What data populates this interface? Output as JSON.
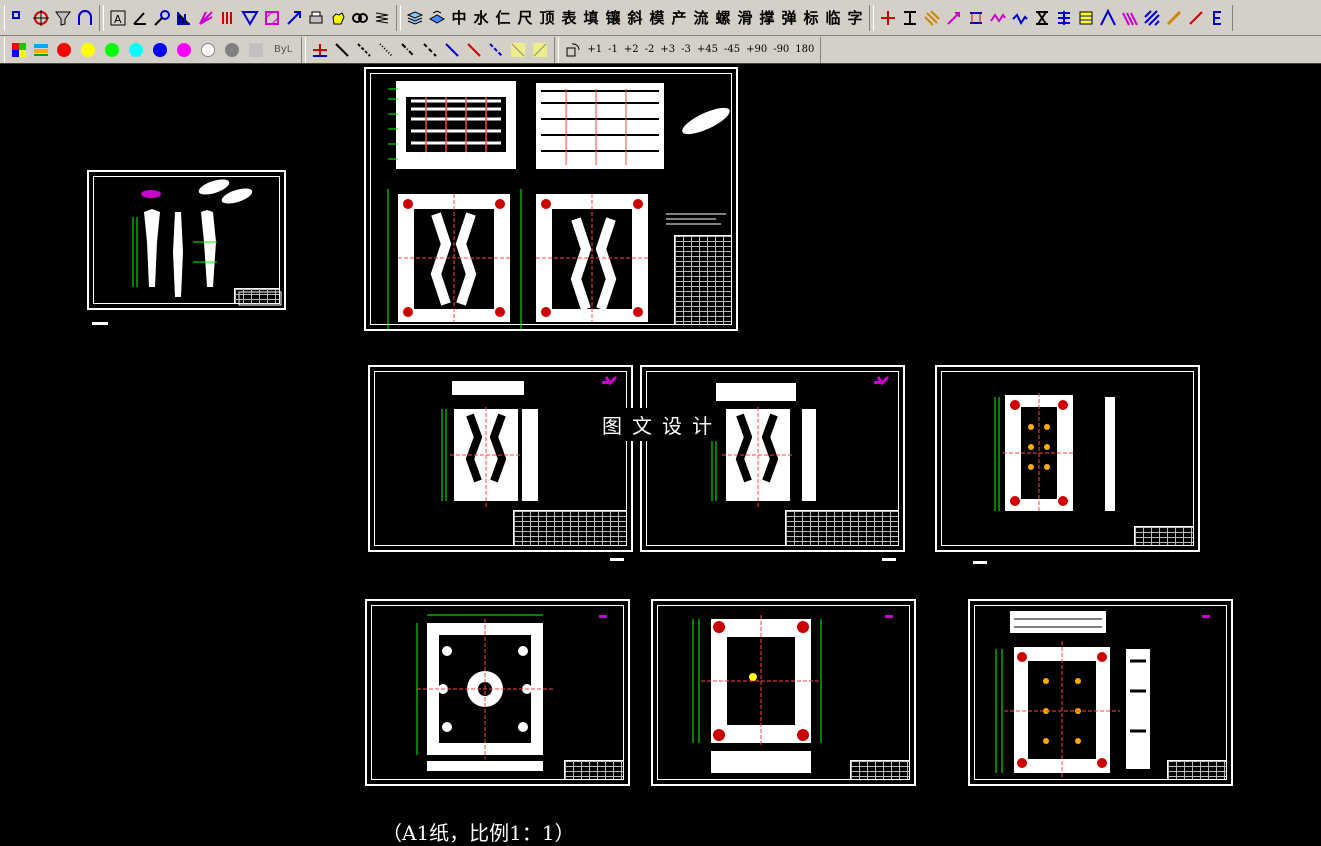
{
  "toolbar1": {
    "cad_commands": [
      "中",
      "水",
      "仁",
      "尺",
      "顶",
      "表",
      "填",
      "镶",
      "斜",
      "模",
      "产",
      "流",
      "螺",
      "滑",
      "撑",
      "弹",
      "标",
      "临",
      "字"
    ]
  },
  "toolbar2": {
    "bylayer_label": "ByL",
    "colors": [
      "#ff0000",
      "#ffff00",
      "#00ff00",
      "#00ffff",
      "#0000ff",
      "#ff00ff",
      "#ffffff",
      "#808080",
      "#c0c0c0"
    ],
    "rotate_buttons": [
      "+1",
      "-1",
      "+2",
      "-2",
      "+3",
      "-3",
      "+45",
      "-45",
      "+90",
      "-90",
      "180"
    ]
  },
  "canvas": {
    "watermark": "图文设计",
    "caption": "（A1纸，比例1：1）"
  }
}
